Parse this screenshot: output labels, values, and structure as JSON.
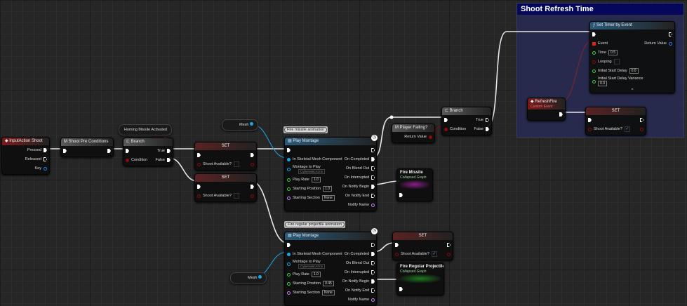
{
  "comment": {
    "title": "Shoot Refresh Time"
  },
  "colors": {
    "exec": "#ffffff",
    "bool": "#8c0b0b",
    "float": "#3ad13a",
    "object": "#1ba6e8",
    "name": "#c47ef5",
    "delegate": "#e02020",
    "struct": "#2a7de0"
  },
  "notes": {
    "fire_missile": "Fire missile animation",
    "fire_regular": "Fire regular projectile animation"
  },
  "pills": {
    "homing": "Homing Missile Activated",
    "mesh_top": "Mesh",
    "mesh_bottom": "Mesh"
  },
  "nodes": [
    {
      "id": "input_action",
      "title": "InputAction Shoot",
      "icon": "event-icon",
      "header": "#7a1a1a",
      "inputs": [],
      "outputs": [
        {
          "label": "Pressed",
          "type": "exec"
        },
        {
          "label": "Released",
          "type": "exec",
          "open": true
        },
        {
          "label": "Key",
          "type": "struct",
          "open": true
        }
      ]
    },
    {
      "id": "shoot_pre",
      "title": "Shoot Pre Conditions",
      "icon": "macro-icon",
      "header": "#5a5a5a",
      "inputs": [
        {
          "label": "",
          "type": "exec"
        }
      ],
      "outputs": [
        {
          "label": "",
          "type": "exec"
        }
      ]
    },
    {
      "id": "branch1",
      "title": "Branch",
      "icon": "branch-icon",
      "header": "#5a5a5a",
      "inputs": [
        {
          "label": "",
          "type": "exec"
        },
        {
          "label": "Condition",
          "type": "bool"
        }
      ],
      "outputs": [
        {
          "label": "True",
          "type": "exec"
        },
        {
          "label": "False",
          "type": "exec"
        }
      ]
    },
    {
      "id": "set1",
      "title": "SET",
      "header": "#5a2222",
      "center": true,
      "inputs": [
        {
          "label": "",
          "type": "exec"
        },
        {
          "label": "Shoot Available?",
          "type": "bool",
          "open": true,
          "check": ""
        }
      ],
      "outputs": [
        {
          "label": "",
          "type": "exec"
        },
        {
          "label": "",
          "type": "bool",
          "open": true
        }
      ]
    },
    {
      "id": "set2",
      "title": "SET",
      "header": "#5a2222",
      "center": true,
      "inputs": [
        {
          "label": "",
          "type": "exec"
        },
        {
          "label": "Shoot Available?",
          "type": "bool",
          "open": true,
          "check": ""
        }
      ],
      "outputs": [
        {
          "label": "",
          "type": "exec"
        },
        {
          "label": "",
          "type": "bool",
          "open": true
        }
      ]
    },
    {
      "id": "play_montage1",
      "title": "Play Montage",
      "icon": "montage-icon",
      "header": "#2a5a7a",
      "inputs": [
        {
          "label": "",
          "type": "exec"
        },
        {
          "label": "In Skeletal Mesh Component",
          "type": "object"
        },
        {
          "label": "Montage to Play",
          "type": "object",
          "open": true,
          "dropdown": "CyberneticArms"
        },
        {
          "label": "Play Rate",
          "type": "float",
          "open": true,
          "value": "1.0"
        },
        {
          "label": "Starting Position",
          "type": "float",
          "open": true,
          "value": "1.0"
        },
        {
          "label": "Starting Section",
          "type": "name",
          "open": true,
          "value": "None"
        }
      ],
      "outputs": [
        {
          "label": "",
          "type": "exec",
          "open": true
        },
        {
          "label": "On Completed",
          "type": "exec"
        },
        {
          "label": "On Blend Out",
          "type": "exec",
          "open": true
        },
        {
          "label": "On Interrupted",
          "type": "exec",
          "open": true
        },
        {
          "label": "On Notify Begin",
          "type": "exec"
        },
        {
          "label": "On Notify End",
          "type": "exec",
          "open": true
        },
        {
          "label": "Notify Name",
          "type": "name",
          "open": true
        }
      ]
    },
    {
      "id": "player_falling",
      "title": "Player Falling?",
      "icon": "macro-icon",
      "header": "#5a5a5a",
      "inputs": [],
      "outputs": [
        {
          "label": "Return Value",
          "type": "bool"
        }
      ]
    },
    {
      "id": "branch2",
      "title": "Branch",
      "icon": "branch-icon",
      "header": "#5a5a5a",
      "inputs": [
        {
          "label": "",
          "type": "exec"
        },
        {
          "label": "Condition",
          "type": "bool"
        }
      ],
      "outputs": [
        {
          "label": "True",
          "type": "exec",
          "open": true
        },
        {
          "label": "False",
          "type": "exec"
        }
      ]
    },
    {
      "id": "fire_missile",
      "title": "Fire Missile",
      "subtitle": "Collapsed Graph",
      "glow": "#8a1f8a",
      "inputs": [
        {
          "label": "",
          "type": "exec"
        }
      ],
      "outputs": []
    },
    {
      "id": "set_timer",
      "title": "Set Timer by Event",
      "icon": "function-icon",
      "header": "#2a5a7a",
      "inputs": [
        {
          "label": "",
          "type": "exec"
        },
        {
          "label": "Event",
          "type": "delegate"
        },
        {
          "label": "Time",
          "type": "float",
          "open": true,
          "value": "0.5"
        },
        {
          "label": "Looping",
          "type": "bool",
          "open": true,
          "check": ""
        },
        {
          "label": "Initial Start Delay",
          "type": "float",
          "open": true,
          "value": "0.0"
        },
        {
          "label": "Initial Start Delay Variance",
          "type": "float",
          "open": true,
          "value": "0.0",
          "below": true
        }
      ],
      "outputs": [
        {
          "label": "",
          "type": "exec",
          "open": true
        },
        {
          "label": "Return Value",
          "type": "struct",
          "open": true
        }
      ],
      "expand": "^"
    },
    {
      "id": "refresh_fire",
      "title": "RefreshFire",
      "subtitle": "Custom Event",
      "icon": "event-icon",
      "header": "#7a1a1a",
      "inputs": [],
      "outputs": [
        {
          "label": "",
          "type": "exec"
        }
      ]
    },
    {
      "id": "set3",
      "title": "SET",
      "header": "#5a2222",
      "center": true,
      "inputs": [
        {
          "label": "",
          "type": "exec"
        },
        {
          "label": "Shoot Available?",
          "type": "bool",
          "open": true,
          "check": "✓"
        }
      ],
      "outputs": [
        {
          "label": "",
          "type": "exec",
          "open": true
        },
        {
          "label": "",
          "type": "bool",
          "open": true
        }
      ]
    },
    {
      "id": "play_montage2",
      "title": "Play Montage",
      "icon": "montage-icon",
      "header": "#2a5a7a",
      "inputs": [
        {
          "label": "",
          "type": "exec"
        },
        {
          "label": "In Skeletal Mesh Component",
          "type": "object"
        },
        {
          "label": "Montage to Play",
          "type": "object",
          "open": true,
          "dropdown": "CyberneticArms"
        },
        {
          "label": "Play Rate",
          "type": "float",
          "open": true,
          "value": "1.0"
        },
        {
          "label": "Starting Position",
          "type": "float",
          "open": true,
          "value": "0.45"
        },
        {
          "label": "Starting Section",
          "type": "name",
          "open": true,
          "value": "None"
        }
      ],
      "outputs": [
        {
          "label": "",
          "type": "exec",
          "open": true
        },
        {
          "label": "On Completed",
          "type": "exec"
        },
        {
          "label": "On Blend Out",
          "type": "exec",
          "open": true
        },
        {
          "label": "On Interrupted",
          "type": "exec",
          "open": true
        },
        {
          "label": "On Notify Begin",
          "type": "exec"
        },
        {
          "label": "On Notify End",
          "type": "exec",
          "open": true
        },
        {
          "label": "Notify Name",
          "type": "name",
          "open": true
        }
      ]
    },
    {
      "id": "set4",
      "title": "SET",
      "header": "#5a2222",
      "center": true,
      "inputs": [
        {
          "label": "",
          "type": "exec"
        },
        {
          "label": "Shoot Available?",
          "type": "bool",
          "open": true,
          "check": "✓"
        }
      ],
      "outputs": [
        {
          "label": "",
          "type": "exec",
          "open": true
        },
        {
          "label": "",
          "type": "bool",
          "open": true
        }
      ]
    },
    {
      "id": "fire_regular",
      "title": "Fire Regular Projectile",
      "subtitle": "Collapsed Graph",
      "glow": "#1f7a1f",
      "inputs": [
        {
          "label": "",
          "type": "exec"
        }
      ],
      "outputs": []
    }
  ]
}
